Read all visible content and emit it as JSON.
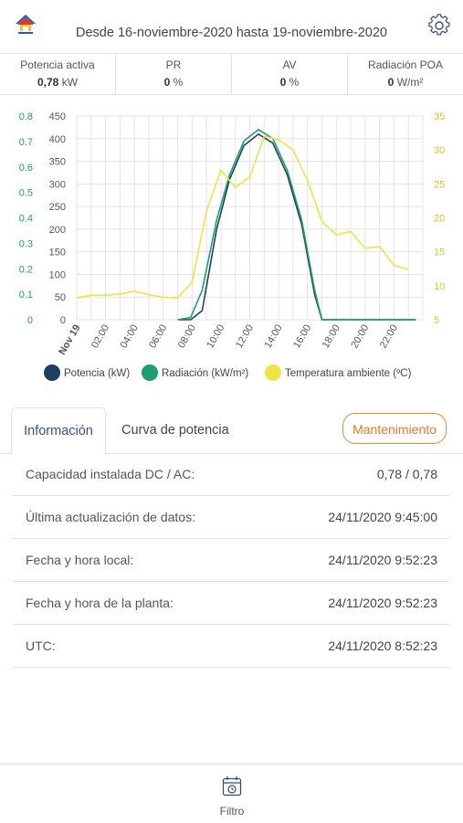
{
  "header": {
    "title": "Desde 16-noviembre-2020 hasta 19-noviembre-2020"
  },
  "stats": [
    {
      "label": "Potencia activa",
      "value": "0,78",
      "unit": "kW"
    },
    {
      "label": "PR",
      "value": "0",
      "unit": "%"
    },
    {
      "label": "AV",
      "value": "0",
      "unit": "%"
    },
    {
      "label": "Radiación POA",
      "value": "0",
      "unit": "W/m²"
    }
  ],
  "chart_data": {
    "type": "line",
    "x_ticks": [
      "Nov 19",
      "02:00",
      "04:00",
      "06:00",
      "08:00",
      "10:00",
      "12:00",
      "14:00",
      "16:00",
      "18:00",
      "20:00",
      "22:00"
    ],
    "axes": {
      "left_outer": {
        "ticks": [
          "0",
          "0.1",
          "0.2",
          "0.3",
          "0.4",
          "0.5",
          "0.6",
          "0.7",
          "0.8"
        ],
        "color": "#1e9e6e"
      },
      "left_inner": {
        "ticks": [
          "0",
          "50",
          "100",
          "150",
          "200",
          "250",
          "300",
          "350",
          "400",
          "450"
        ],
        "range": [
          0,
          450
        ]
      },
      "right": {
        "ticks": [
          "5",
          "10",
          "15",
          "20",
          "25",
          "30",
          "35"
        ],
        "range": [
          5,
          35
        ],
        "color": "#d4c72a"
      }
    },
    "grid": true,
    "legend_position": "bottom",
    "series": [
      {
        "name": "Potencia (kW)",
        "color": "#1f3f5e",
        "axis": "left_inner",
        "x": [
          7.0,
          7.9,
          8.7,
          9.7,
          10.6,
          11.6,
          12.6,
          13.6,
          14.6,
          15.6,
          16.5,
          17,
          18,
          20,
          22,
          23.5
        ],
        "y": [
          0,
          0,
          20,
          200,
          310,
          385,
          410,
          390,
          320,
          210,
          55,
          0,
          0,
          0,
          0,
          0
        ]
      },
      {
        "name": "Radiación (kW/m²)",
        "color": "#1e9e6e",
        "axis": "left_inner",
        "x": [
          7.0,
          7.9,
          8.7,
          9.7,
          10.6,
          11.6,
          12.6,
          13.6,
          14.6,
          15.6,
          16.5,
          17,
          18,
          20,
          22,
          23.5
        ],
        "y": [
          0,
          5,
          65,
          220,
          320,
          395,
          420,
          400,
          330,
          220,
          65,
          0,
          0,
          0,
          0,
          0
        ]
      },
      {
        "name": "Temperatura ambiente (ºC)",
        "color": "#f1e247",
        "axis": "right",
        "x": [
          0,
          1,
          2,
          3,
          4,
          5,
          6,
          7,
          8,
          9,
          10,
          11,
          12,
          13,
          14,
          15,
          16,
          17,
          18,
          19,
          20,
          21,
          22,
          23
        ],
        "y": [
          8.2,
          8.6,
          8.6,
          8.8,
          9.2,
          8.7,
          8.3,
          8.2,
          10.5,
          21,
          27,
          24.5,
          26,
          32,
          31.5,
          30,
          25.5,
          19.5,
          17.5,
          18,
          15.5,
          15.8,
          13,
          12.4
        ]
      }
    ]
  },
  "tabs": {
    "info": "Información",
    "curve": "Curva de potencia"
  },
  "maintenance_label": "Mantenimiento",
  "info_rows": [
    {
      "label": "Capacidad instalada DC / AC:",
      "value": "0,78 / 0,78"
    },
    {
      "label": "Última actualización de datos:",
      "value": "24/11/2020 9:45:00"
    },
    {
      "label": "Fecha y hora local:",
      "value": "24/11/2020 9:52:23"
    },
    {
      "label": "Fecha y hora de la planta:",
      "value": "24/11/2020 9:52:23"
    },
    {
      "label": "UTC:",
      "value": "24/11/2020 8:52:23"
    }
  ],
  "bottom": {
    "filter_label": "Filtro"
  },
  "icons": {
    "logo": "house-logo-icon",
    "settings": "gear-icon",
    "filter": "calendar-clock-icon"
  }
}
